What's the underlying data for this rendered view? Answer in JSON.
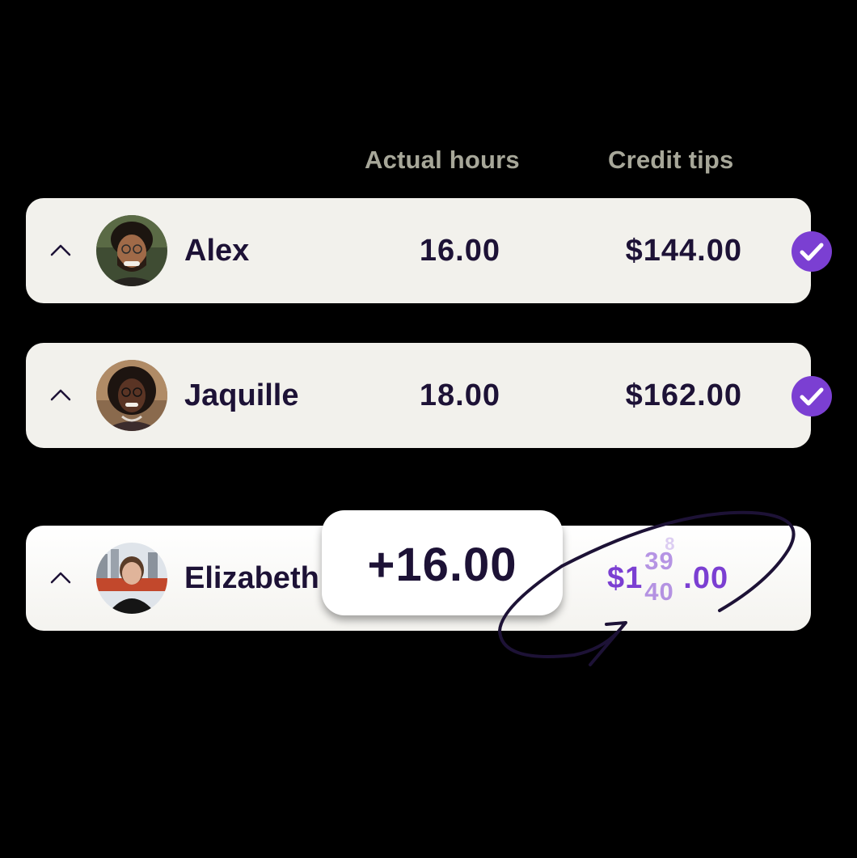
{
  "columns": {
    "hours_label": "Actual hours",
    "tips_label": "Credit tips"
  },
  "rows": [
    {
      "name": "Alex",
      "hours": "16.00",
      "tips": "$144.00",
      "status": "check-circle-icon"
    },
    {
      "name": "Jaquille",
      "hours": "18.00",
      "tips": "$162.00",
      "status": "check-circle-icon"
    },
    {
      "name": "Elizabeth",
      "tips_prefix": "$1",
      "tips_rolling_prev": "8",
      "tips_rolling_mid": "39",
      "tips_rolling_current": "9",
      "tips_rolling_next": "40",
      "tips_suffix": ".00"
    }
  ],
  "hours_delta_bubble": "+16.00",
  "colors": {
    "background": "#000000",
    "row_bg": "#f2f1ec",
    "text_dark": "#1d1236",
    "header_gray": "#a7a799",
    "accent_purple": "#7b3fd2"
  }
}
